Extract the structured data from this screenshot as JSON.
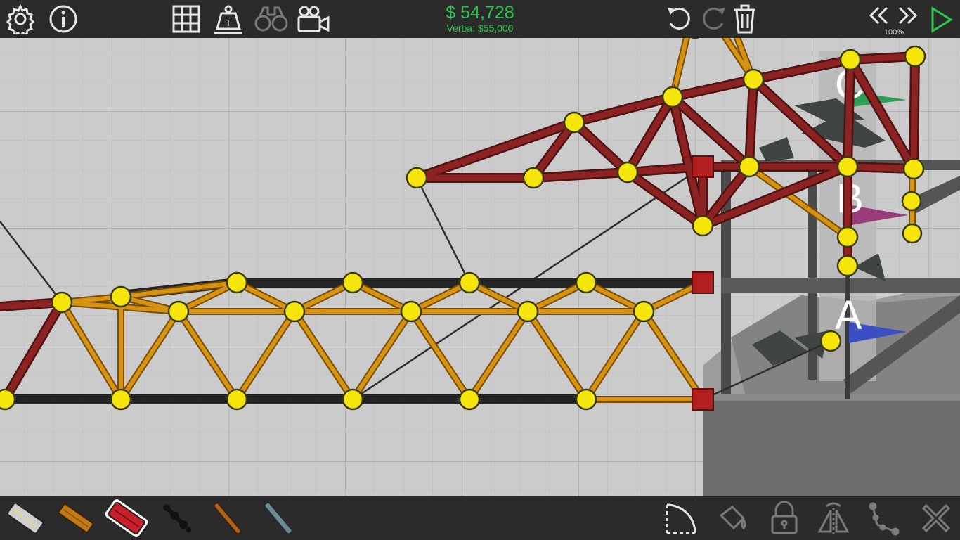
{
  "toolbar": {
    "budget_amount": "$ 54,728",
    "budget_limit": "Verba: $55,000",
    "speed_label": "100%",
    "left_icons": [
      "gear-icon",
      "info-icon",
      "grid-icon",
      "weight-icon",
      "binoculars-icon",
      "camera-icon"
    ],
    "right_icons": [
      "undo-icon",
      "redo-icon",
      "trash-icon",
      "rewind-icon",
      "fast-forward-icon",
      "play-icon"
    ]
  },
  "materials": [
    "road-material",
    "wood-material",
    "reinforced-road-material",
    "rope-material",
    "cable-material",
    "steel-material"
  ],
  "selected_material": "reinforced-road-material",
  "bottom_tools": [
    "arc-tool-icon",
    "paint-bucket-icon",
    "lock-icon",
    "mirror-icon",
    "split-joint-icon",
    "close-icon"
  ],
  "checkpoints": [
    {
      "label": "A",
      "color": "#3b4fc2"
    },
    {
      "label": "B",
      "color": "#9b3c7a"
    },
    {
      "label": "C",
      "color": "#2f9c57"
    }
  ],
  "colors": {
    "wood": "#d7920f",
    "steel": "#8d2222",
    "road": "#252525",
    "joint": "#f5e50a",
    "anchor": "#b32020",
    "accent": "#2bc94b"
  }
}
